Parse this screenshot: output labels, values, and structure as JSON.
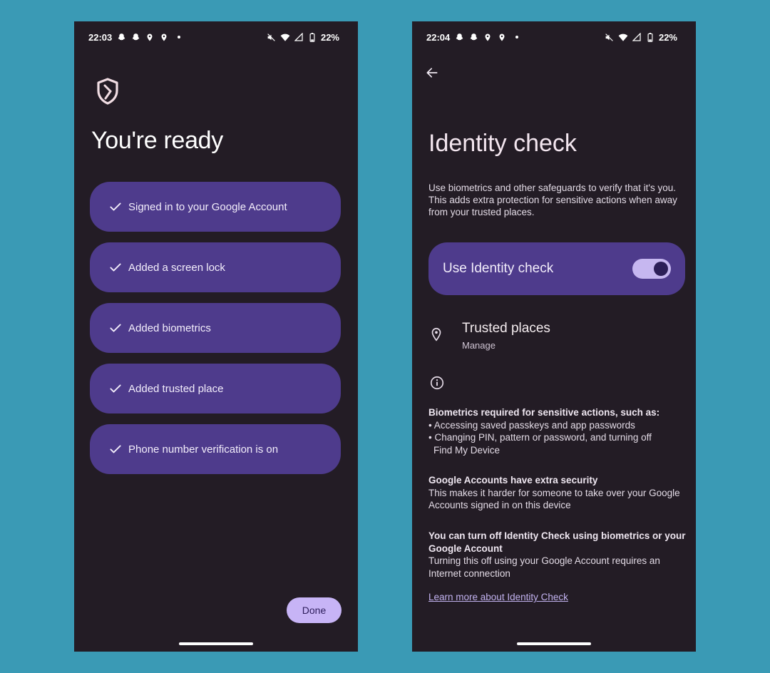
{
  "left_screen": {
    "status_bar": {
      "time": "22:03",
      "battery": "22%"
    },
    "title": "You're ready",
    "items": [
      {
        "label": "Signed in to your Google Account"
      },
      {
        "label": "Added a screen lock"
      },
      {
        "label": "Added biometrics"
      },
      {
        "label": "Added trusted place"
      },
      {
        "label": "Phone number verification is on"
      }
    ],
    "done_label": "Done"
  },
  "right_screen": {
    "status_bar": {
      "time": "22:04",
      "battery": "22%"
    },
    "title": "Identity check",
    "intro": "Use biometrics and other safeguards to verify that it's you. This adds extra protection for sensitive actions when away from your trusted places.",
    "toggle": {
      "label": "Use Identity check",
      "on": true
    },
    "trusted_places": {
      "title": "Trusted places",
      "subtitle": "Manage"
    },
    "biometrics": {
      "heading": "Biometrics required for sensitive actions, such as:",
      "bullet_1": "• Accessing saved passkeys and app passwords",
      "bullet_2_line1": "• Changing PIN, pattern or password, and turning off",
      "bullet_2_line2": "Find My Device"
    },
    "accounts": {
      "heading": "Google Accounts have extra security",
      "body": "This makes it harder for someone to take over your Google Accounts signed in on this device"
    },
    "turn_off": {
      "heading": "You can turn off Identity Check using biometrics or your Google Account",
      "body": "Turning this off using your Google Account requires an Internet connection"
    },
    "learn_more": "Learn more about Identity Check"
  },
  "colors": {
    "page_background": "#3a9ab5",
    "screen_background": "#231c25",
    "card": "#4e3b8c",
    "accent": "#c7b4f6"
  }
}
